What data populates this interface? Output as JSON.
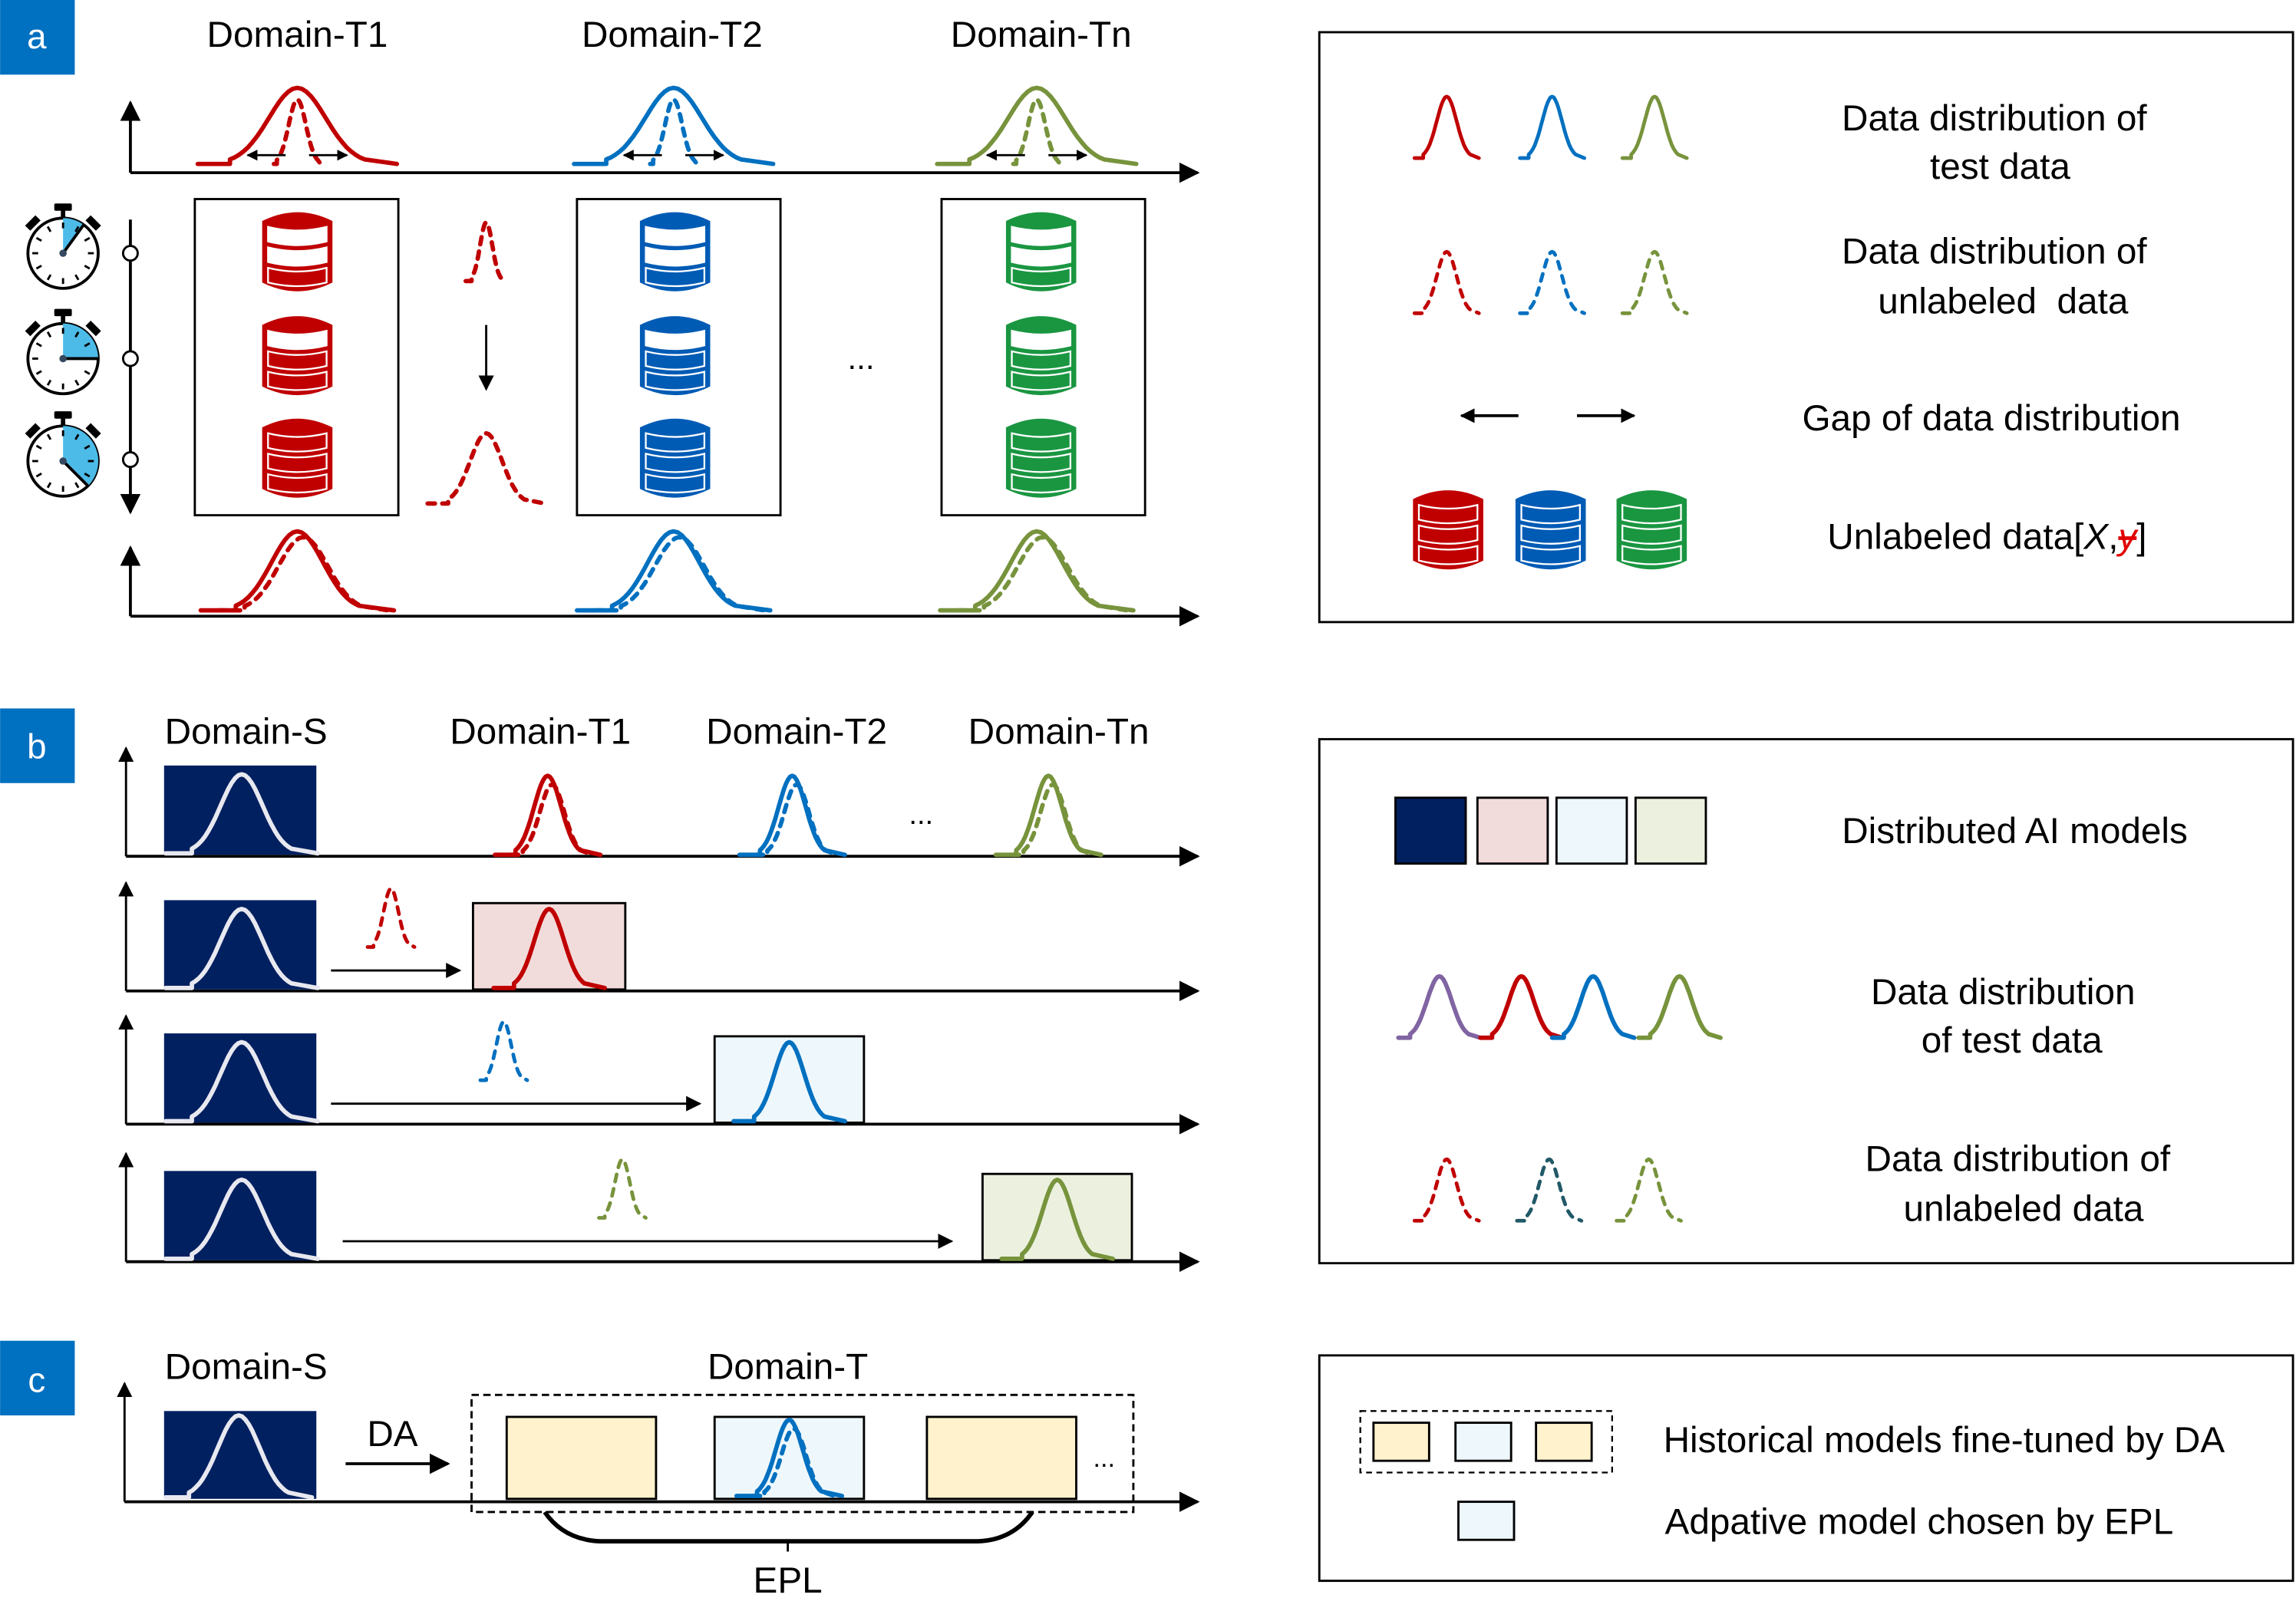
{
  "colors": {
    "tag_blue": "#0070c0",
    "red": "#c00000",
    "blue": "#0070c0",
    "olive": "#77933c",
    "green": "#1a9641",
    "db_blue": "#005bb5",
    "purple": "#8064a2",
    "teal": "#215967",
    "navy": "#002060",
    "pink_fill": "#f2dcdb",
    "lightblue_fill": "#eef7fb",
    "lightgreen_fill": "#ebf1de",
    "yellow_fill": "#fff2cc",
    "clock_fill": "#4dbbe8"
  },
  "panel_a": {
    "tag": "a",
    "domains": [
      "Domain-T1",
      "Domain-T2",
      "Domain-Tn"
    ],
    "ellipsis": "...",
    "clock_fractions": [
      0.1,
      0.25,
      0.375
    ],
    "legend": {
      "items": [
        {
          "label_lines": [
            "Data distribution of",
            "test data"
          ]
        },
        {
          "label_lines": [
            "Data distribution of",
            "unlabeled  data"
          ]
        },
        {
          "label_lines": [
            "Gap of data distribution"
          ]
        },
        {
          "label_prefix": "Unlabeled data[",
          "label_x": "X",
          "label_comma": ",",
          "label_y": "y",
          "label_suffix": "]"
        }
      ]
    }
  },
  "panel_b": {
    "tag": "b",
    "domains": [
      "Domain-S",
      "Domain-T1",
      "Domain-T2",
      "Domain-Tn"
    ],
    "ellipsis": "...",
    "legend": {
      "items": [
        {
          "label_lines": [
            "Distributed AI models"
          ]
        },
        {
          "label_lines": [
            "Data distribution",
            "of test data"
          ]
        },
        {
          "label_lines": [
            "Data distribution of",
            "unlabeled data"
          ]
        }
      ]
    }
  },
  "panel_c": {
    "tag": "c",
    "source_domain": "Domain-S",
    "target_domain": "Domain-T",
    "da_label": "DA",
    "epl_label": "EPL",
    "ellipsis": "...",
    "legend": {
      "items": [
        {
          "label_lines": [
            "Historical models fine-tuned by DA"
          ]
        },
        {
          "label_lines": [
            "Adpative model chosen by EPL"
          ]
        }
      ]
    }
  }
}
